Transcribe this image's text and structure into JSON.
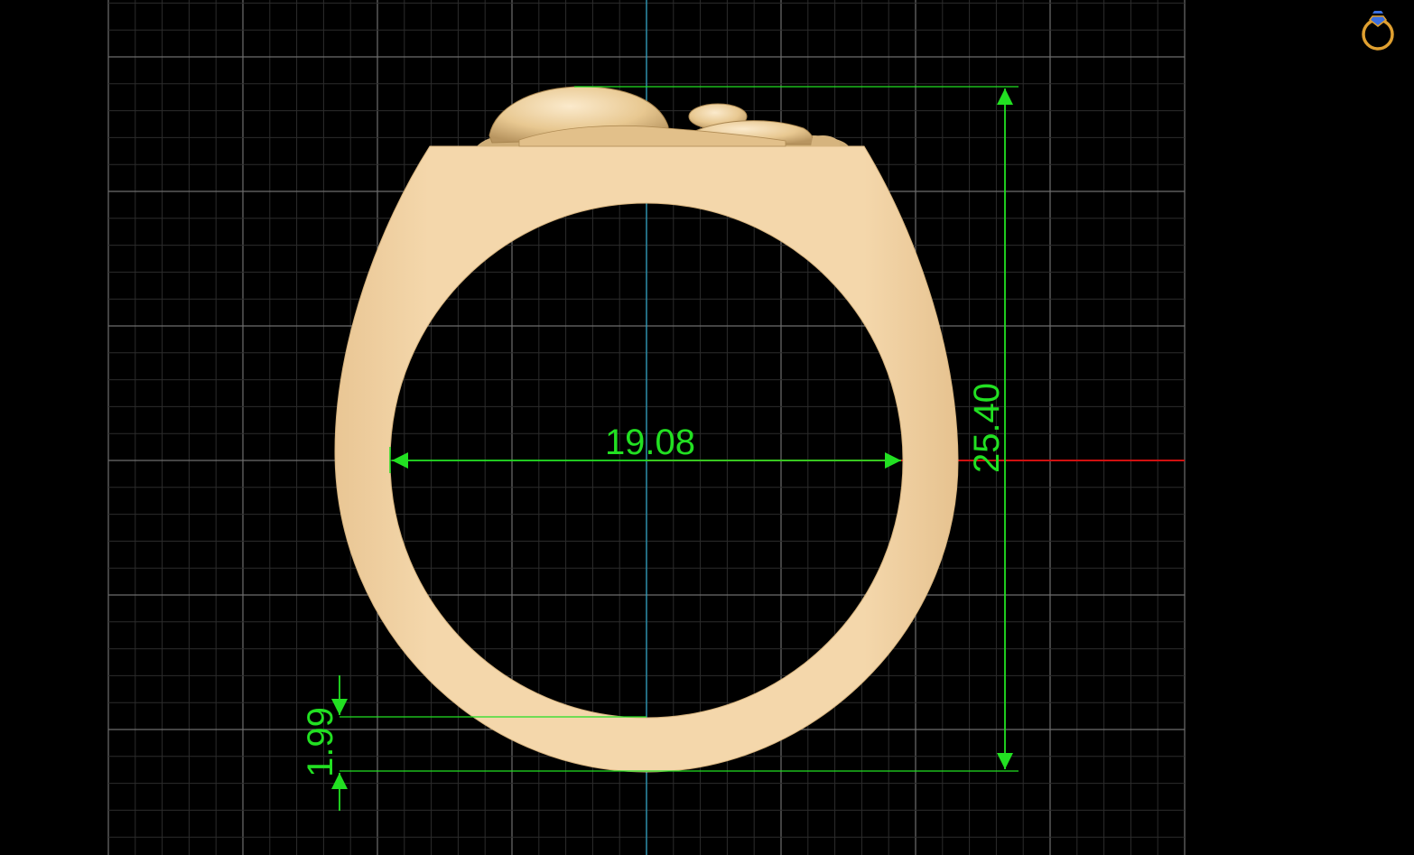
{
  "viewport": {
    "background": "#000000",
    "grid_minor_color": "#2c2c2c",
    "grid_major_color": "#6e6e6e",
    "axis_vertical_color": "#2aa6c8",
    "axis_horizontal_color": "#d01010"
  },
  "ring": {
    "metal_color": "#f2d3a4",
    "metal_shadow": "#dcb97f"
  },
  "dimensions": {
    "inner_diameter": "19.08",
    "total_height": "25.40",
    "band_thickness": "1.99",
    "color": "#22e022"
  },
  "icons": {
    "corner_icon": "ring-icon",
    "corner_icon_color": "#e0a030",
    "corner_gem_color": "#3a6fe0"
  }
}
